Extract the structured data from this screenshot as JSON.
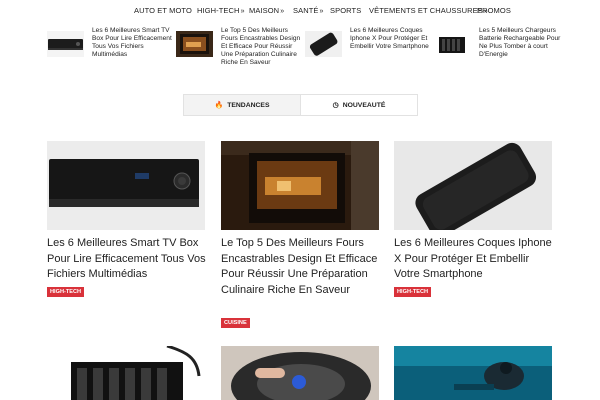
{
  "nav": [
    {
      "label": "AUTO ET MOTO",
      "chevron": false
    },
    {
      "label": "HIGH-TECH",
      "chevron": true
    },
    {
      "label": "MAISON",
      "chevron": true
    },
    {
      "label": "SANTÉ",
      "chevron": true
    },
    {
      "label": "SPORTS",
      "chevron": false
    },
    {
      "label": "VÊTEMENTS ET CHAUSSURES",
      "chevron": true
    },
    {
      "label": "PROMOS",
      "chevron": false
    }
  ],
  "strip": [
    {
      "text": "Les 6 Meilleures Smart TV Box Pour Lire Efficacement Tous Vos Fichiers Multimédias"
    },
    {
      "text": "Le Top 5 Des Meilleurs Fours Encastrables Design Et Efficace Pour Réussir Une Préparation Culinaire Riche En Saveur"
    },
    {
      "text": "Les 6 Meilleures Coques Iphone X Pour Protéger Et Embellir Votre Smartphone"
    },
    {
      "text": "Les 5 Meilleurs Chargeurs Batterie Rechargeable Pour Ne Plus Tomber à court D'Energie"
    }
  ],
  "tabs": [
    {
      "label": "TENDANCES",
      "icon": "flame-icon"
    },
    {
      "label": "NOUVEAUTÉ",
      "icon": "clock-icon"
    }
  ],
  "cards": [
    {
      "title": "Les 6 Meilleures Smart TV Box Pour Lire Efficacement Tous Vos Fichiers Multimédias",
      "badge": "HIGH-TECH"
    },
    {
      "title": "Le Top 5 Des Meilleurs Fours Encastrables Design Et Efficace Pour Réussir Une Préparation Culinaire Riche En Saveur",
      "badge": "CUISINE"
    },
    {
      "title": "Les 6 Meilleures Coques Iphone X Pour Protéger Et Embellir Votre Smartphone",
      "badge": "HIGH-TECH"
    }
  ],
  "colors": {
    "badge": "#d9323a",
    "tab_active": "#f3f3f3"
  }
}
